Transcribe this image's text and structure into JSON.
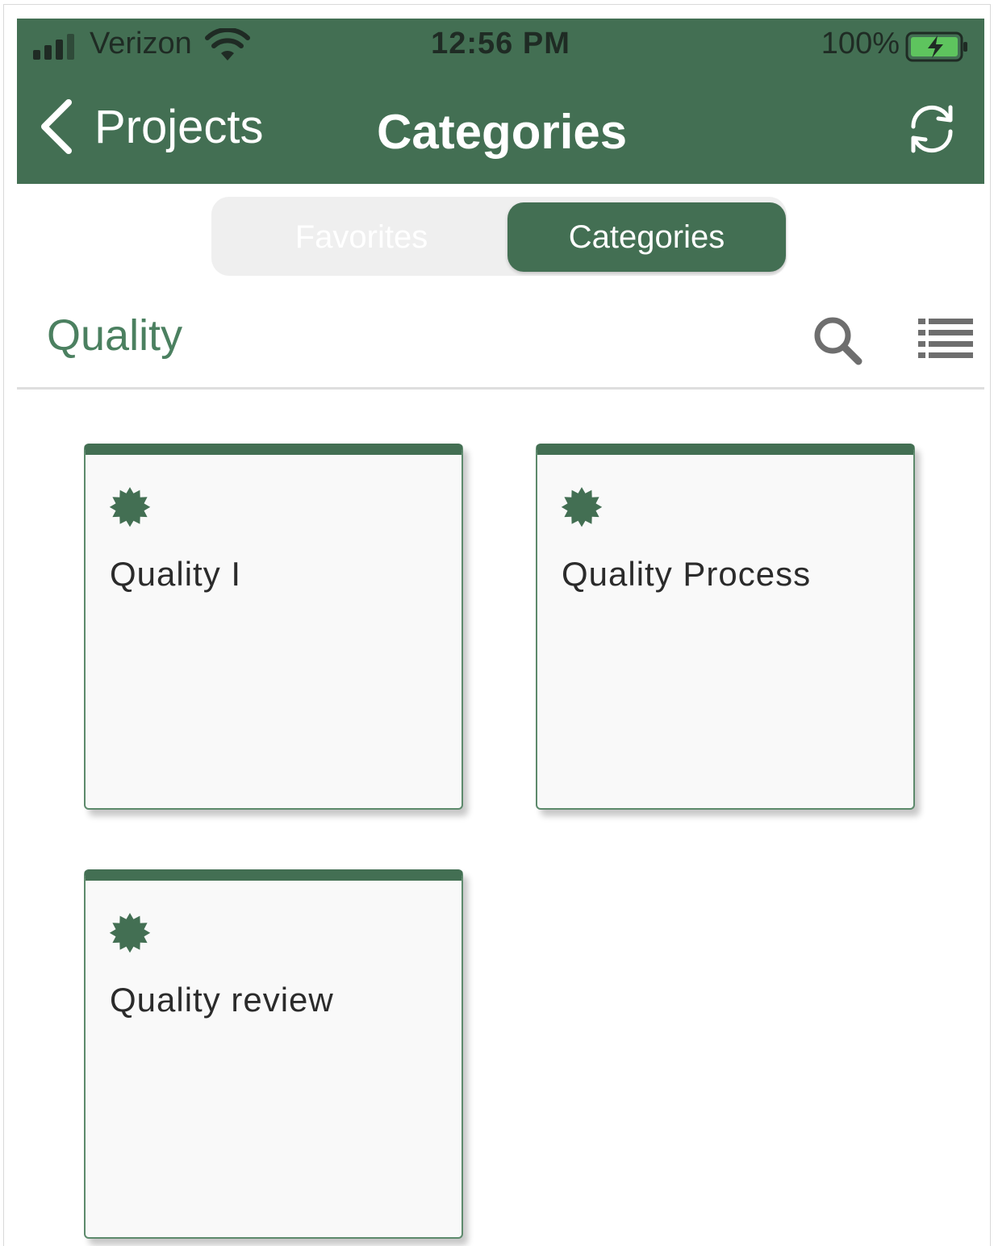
{
  "status_bar": {
    "carrier": "Verizon",
    "time": "12:56 PM",
    "battery": "100%"
  },
  "nav": {
    "back_label": "Projects",
    "title": "Categories",
    "refresh_icon": "refresh-icon"
  },
  "segments": {
    "favorites": "Favorites",
    "categories": "Categories",
    "selected": "Categories"
  },
  "section": {
    "title": "Quality",
    "search_icon": "search-icon",
    "list_icon": "list-view-icon"
  },
  "cards": [
    {
      "label": "Quality I",
      "icon": "badge-icon"
    },
    {
      "label": "Quality Process",
      "icon": "badge-icon"
    },
    {
      "label": "Quality review",
      "icon": "badge-icon"
    }
  ],
  "colors": {
    "primary": "#436f53",
    "accent_text": "#4b8060",
    "segment_bg": "#efefef",
    "card_bg": "#f9f9f9"
  }
}
